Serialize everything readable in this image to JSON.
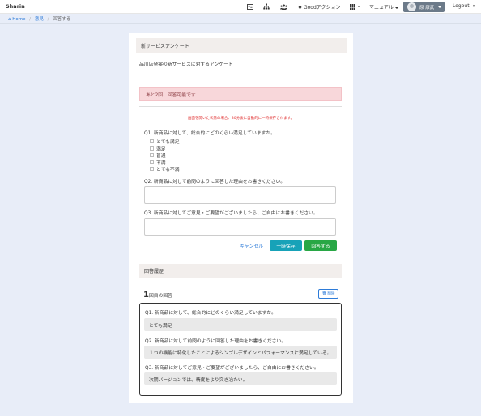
{
  "navbar": {
    "brand": "Sharin",
    "icons": [
      "id-card-icon",
      "sitemap-icon",
      "users-icon"
    ],
    "good_action_label": "Goodアクション",
    "apps_icon": "grid-icon",
    "manual_label": "マニュアル",
    "user_name": "原 康武",
    "logout_label": "Logout"
  },
  "breadcrumb": {
    "home": "Home",
    "level1": "意見",
    "current": "回答する"
  },
  "survey": {
    "title": "新サービスアンケート",
    "description": "品川店発案の新サービスに対するアンケート",
    "alert": "あと2回、回答可能です",
    "warning": "画面を開いた状態の場合、30分後に自動的に一時保存されます。",
    "q1": "Q1. 新商品に対して、総合的にどのくらい満足していますか。",
    "q1_options": [
      "とても満足",
      "満足",
      "普通",
      "不満",
      "とても不満"
    ],
    "q2": "Q2. 新商品に対して前問のように回答した理由をお書きください。",
    "q3": "Q3. 新商品に対してご意見・ご要望がございましたら、ご自由にお書きください。",
    "cancel": "キャンセル",
    "save_draft": "一時保存",
    "submit": "回答する"
  },
  "history": {
    "title": "回答履歴",
    "answer_number": "1",
    "answer_label": "回目の回答",
    "delete": "削除",
    "items": [
      {
        "question": "Q1. 新商品に対して、総合的にどのくらい満足していますか。",
        "answer": "とても満足"
      },
      {
        "question": "Q2. 新商品に対して前問のように回答した理由をお書きください。",
        "answer": "１つの機能に特化したことによるシンプルデザインとパフォーマンスに満足している。"
      },
      {
        "question": "Q3. 新商品に対してご意見・ご要望がございましたら、ご自由にお書きください。",
        "answer": "次期バージョンでは、精度をより突き冶たい。"
      }
    ]
  },
  "colors": {
    "primary": "#2d7bd8",
    "info": "#17a2b8",
    "success": "#28a745",
    "alert_bg": "#f8d7da",
    "page_bg": "#e8edf8"
  }
}
